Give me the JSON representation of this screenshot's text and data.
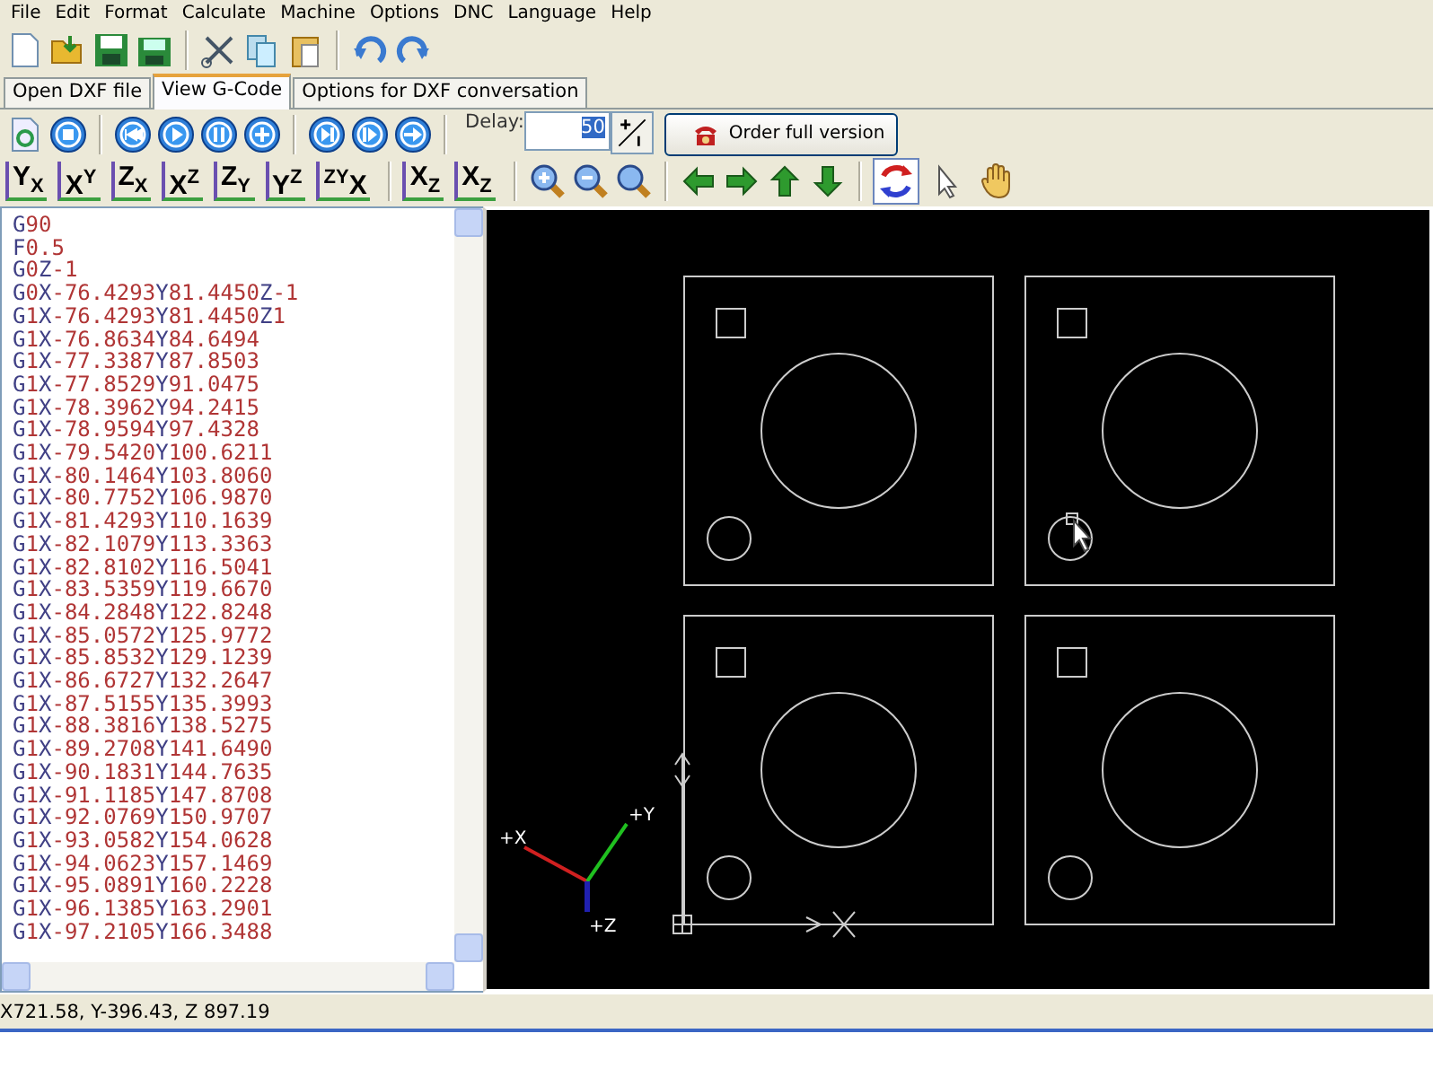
{
  "menu": [
    "File",
    "Edit",
    "Format",
    "Calculate",
    "Machine",
    "Options",
    "DNC",
    "Language",
    "Help"
  ],
  "tabs": [
    {
      "label": "Open DXF file",
      "selected": false
    },
    {
      "label": "View G-Code",
      "selected": true
    },
    {
      "label": "Options for DXF conversation",
      "selected": false
    }
  ],
  "delay": {
    "label": "Delay:",
    "value": "50"
  },
  "order_button": "Order full version",
  "plane_buttons": [
    "Y$_{X}$",
    "X$^{Y}$",
    "Z$_{X}$",
    "X$^{Z}$",
    "Z$_{Y}$",
    "Y$^{Z}$",
    "$^{ZY}$X",
    "X$_{Z}$",
    "X$_{Z}$"
  ],
  "tools": [
    {
      "kind": "rotate",
      "selected": true
    },
    {
      "kind": "pointer",
      "selected": false
    },
    {
      "kind": "hand",
      "selected": false
    }
  ],
  "gcode": [
    "G90",
    "F0.5",
    "G0Z-1",
    "G0X-76.4293Y81.4450Z-1",
    "G1X-76.4293Y81.4450Z1",
    "G1X-76.8634Y84.6494",
    "G1X-77.3387Y87.8503",
    "G1X-77.8529Y91.0475",
    "G1X-78.3962Y94.2415",
    "G1X-78.9594Y97.4328",
    "G1X-79.5420Y100.6211",
    "G1X-80.1464Y103.8060",
    "G1X-80.7752Y106.9870",
    "G1X-81.4293Y110.1639",
    "G1X-82.1079Y113.3363",
    "G1X-82.8102Y116.5041",
    "G1X-83.5359Y119.6670",
    "G1X-84.2848Y122.8248",
    "G1X-85.0572Y125.9772",
    "G1X-85.8532Y129.1239",
    "G1X-86.6727Y132.2647",
    "G1X-87.5155Y135.3993",
    "G1X-88.3816Y138.5275",
    "G1X-89.2708Y141.6490",
    "G1X-90.1831Y144.7635",
    "G1X-91.1185Y147.8708",
    "G1X-92.0769Y150.9707",
    "G1X-93.0582Y154.0628",
    "G1X-94.0623Y157.1469",
    "G1X-95.0891Y160.2228",
    "G1X-96.1385Y163.2901",
    "G1X-97.2105Y166.3488"
  ],
  "axes": {
    "x": "+X",
    "y": "+Y",
    "z": "+Z"
  },
  "status_bar": "X721.58, Y-396.43, Z 897.19"
}
